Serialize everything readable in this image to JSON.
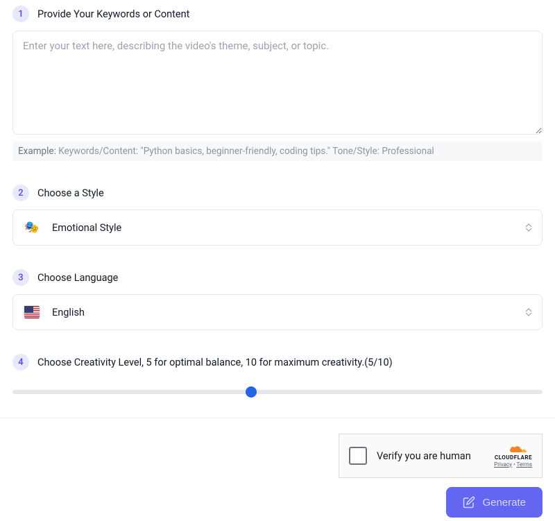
{
  "steps": {
    "s1": {
      "num": "1",
      "title": "Provide Your Keywords or Content"
    },
    "s2": {
      "num": "2",
      "title": "Choose a Style"
    },
    "s3": {
      "num": "3",
      "title": "Choose Language"
    },
    "s4": {
      "num": "4",
      "title": "Choose Creativity Level, 5 for optimal balance, 10 for maximum creativity.(5/10)"
    }
  },
  "input": {
    "placeholder": "Enter your text here, describing the video's theme, subject, or topic."
  },
  "example": {
    "label": "Example:  ",
    "text": "Keywords/Content: \"Python basics, beginner-friendly, coding tips.\" Tone/Style: Professional"
  },
  "style": {
    "selected": "Emotional Style",
    "emoji": "🎭"
  },
  "language": {
    "selected": "English"
  },
  "creativity": {
    "value": 5,
    "min": 1,
    "max": 10,
    "percent": 45
  },
  "captcha": {
    "text": "Verify you are human",
    "brand": "CLOUDFLARE",
    "privacy": "Privacy",
    "terms": "Terms"
  },
  "generate": {
    "label": "Generate"
  },
  "colors": {
    "accent": "#6366f1",
    "slider": "#2563eb",
    "badge_bg": "#e7e9fb",
    "badge_fg": "#4f46e5"
  }
}
